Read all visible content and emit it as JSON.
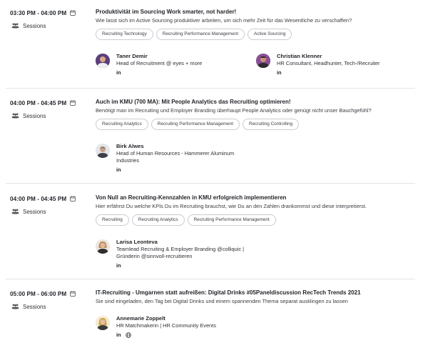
{
  "sessions": [
    {
      "time": "03:30 PM - 04:00 PM",
      "type": "Sessions",
      "title": "Produktivität im Sourcing Work smarter, not harder!",
      "description": "Wie lasst sich im Active Sourcing produktiver arbeiten, um sich mehr Zeit für das Wesentliche zu verschaffen?",
      "tags": [
        "Recruiting Technology",
        "Recruiting Performance Management",
        "Active Sourcing"
      ],
      "speakers": [
        {
          "name": "Taner Demir",
          "role": [
            "Head of Recruitment @ eyes + more"
          ],
          "links": [
            "in"
          ]
        },
        {
          "name": "Christian Klenner",
          "role": [
            "HR Consultant, Headhunter, Tech-/Recruiter"
          ],
          "links": [
            "in"
          ]
        }
      ]
    },
    {
      "time": "04:00 PM - 04:45 PM",
      "type": "Sessions",
      "title": "Auch im KMU (700 MA): Mit People Analytics das Recruiting optimieren!",
      "description": "Benötigt man im Recruiting und Employer Branding überhaupt People Analytics oder genügt nicht unser Bauchgefühl?",
      "tags": [
        "Recruiting Analytics",
        "Recruiting Performance Management",
        "Recruiting Controlling"
      ],
      "speakers": [
        {
          "name": "Birk Alwes",
          "role": [
            "Head of Human Resources - Hammerer Aluminum",
            "Industries"
          ],
          "links": [
            "in"
          ]
        }
      ]
    },
    {
      "time": "04:00 PM - 04:45 PM",
      "type": "Sessions",
      "title": "Von Null an Recruiting-Kennzahlen in KMU erfolgreich implementieren",
      "description": "Hier erfährst Du welche KPIs Du im Recruiting brauchst, wie Du an den Zahlen drankommst und diese interpretierst.",
      "tags": [
        "Recruiting",
        "Recruiting Analytics",
        "Recruiting Performance Management"
      ],
      "speakers": [
        {
          "name": "Larisa Leonteva",
          "role": [
            "Teamlead Recruiting & Employer Branding @colliquic |",
            "Gründerin @sinnvoll-recruitieren"
          ],
          "links": [
            "in"
          ]
        }
      ]
    },
    {
      "time": "05:00 PM - 06:00 PM",
      "type": "Sessions",
      "title": "IT-Recruiting - Umgarnen statt aufreißen: Digital Drinks #05Paneldiscussion RecTech Trends 2021",
      "description": "Sie sind eingeladen, den Tag bei Digital Drinks und einem spannenden Thema separat ausklingen zu lassen",
      "tags": [],
      "speakers": [
        {
          "name": "Annemarie Zoppelt",
          "role": [
            "HR Matchmakerin | HR Community Events"
          ],
          "links": [
            "in",
            "globe-icon"
          ]
        }
      ]
    }
  ],
  "icons": {
    "calendar": "calendar-icon",
    "type": "people-icon",
    "linkedin": "linkedin-icon",
    "web": "globe-icon"
  },
  "colors": {
    "text": "#1f2226",
    "border": "#c9ccd1",
    "separator": "#e3e5e8"
  }
}
